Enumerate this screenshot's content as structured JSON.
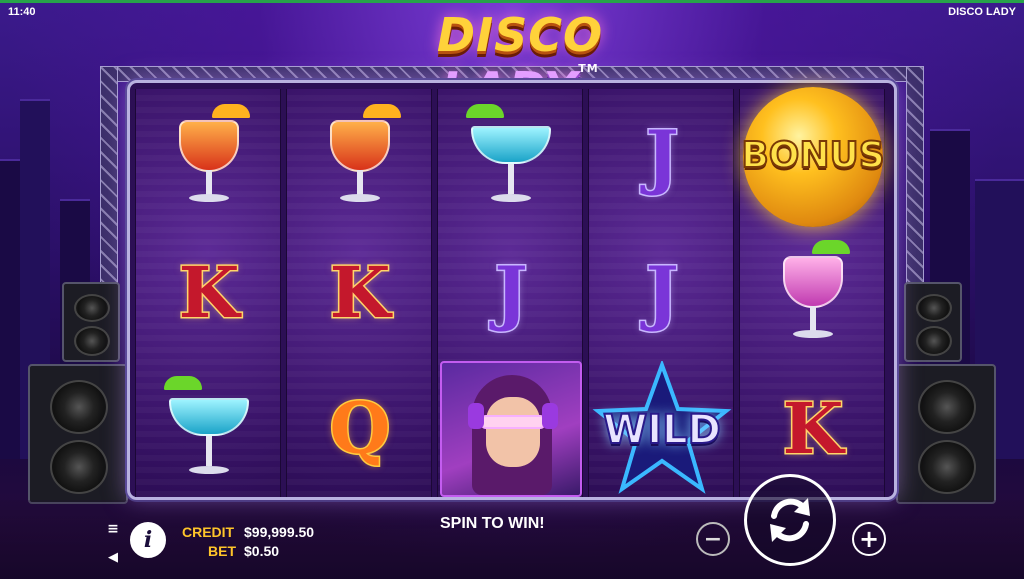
{
  "status_bar": {
    "time": "11:40",
    "game_name": "DISCO LADY"
  },
  "logo": {
    "word1": "DISCO",
    "word2": "LADY",
    "tm": "TM"
  },
  "reels": [
    [
      "cocktail-red",
      "K",
      "cocktail-blue"
    ],
    [
      "cocktail-red",
      "K",
      "Q"
    ],
    [
      "cocktail-blue",
      "J",
      "disco-lady"
    ],
    [
      "J",
      "J",
      "wild"
    ],
    [
      "bonus",
      "cocktail-pink",
      "K"
    ]
  ],
  "symbols": {
    "bonus_label": "BONUS",
    "wild_label": "WILD",
    "K": "K",
    "J": "J",
    "Q": "Q"
  },
  "bottom": {
    "credit_label": "CREDIT",
    "credit_value": "$99,999.50",
    "bet_label": "BET",
    "bet_value": "$0.50",
    "message": "SPIN TO WIN!",
    "minus": "−",
    "plus": "+",
    "info": "i"
  }
}
